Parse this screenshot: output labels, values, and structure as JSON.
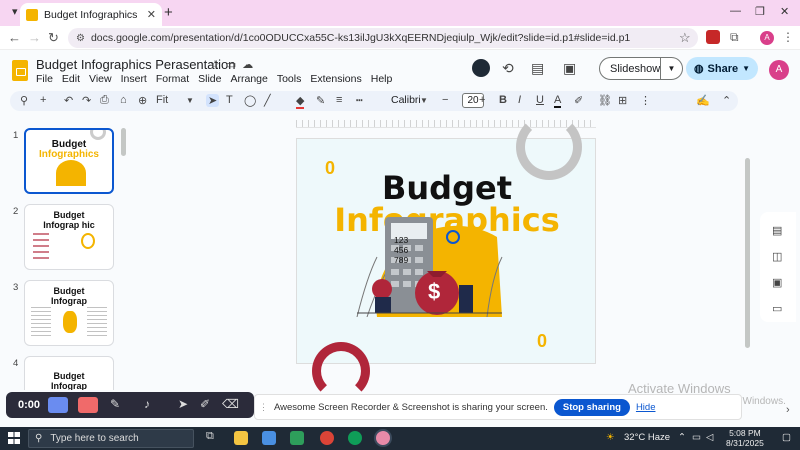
{
  "browser": {
    "tab_title": "Budget Infographics Perasentation",
    "url": "docs.google.com/presentation/d/1co0ODUCCxa55C-ks13ilJgU3kXqEERNDjeqiulp_Wjk/edit?slide=id.p1#slide=id.p1"
  },
  "doc": {
    "title": "Budget Infographics Perasentation",
    "menu": [
      "File",
      "Edit",
      "View",
      "Insert",
      "Format",
      "Slide",
      "Arrange",
      "Tools",
      "Extensions",
      "Help"
    ],
    "slideshow_label": "Slideshow",
    "share_label": "Share",
    "avatar_letter": "A"
  },
  "toolbar": {
    "zoom": "Fit",
    "font": "Calibri",
    "font_size": "20"
  },
  "filmstrip": {
    "slides": [
      {
        "num": "1",
        "title": "Budget",
        "subtitle": "Infographics"
      },
      {
        "num": "2",
        "title": "Budget",
        "subtitle": "Infograp hic"
      },
      {
        "num": "3",
        "title": "Budget",
        "subtitle": "Infograp"
      },
      {
        "num": "4",
        "title": "Budget",
        "subtitle": "Infograp"
      }
    ]
  },
  "slide": {
    "title_line1": "Budget",
    "title_line2": "Infographics",
    "calculator_display": [
      "123",
      "456",
      "789"
    ],
    "dollar_sign": "$",
    "zero_symbol": "0"
  },
  "watermark": {
    "line1": "Activate Windows",
    "line2": "Go to Settings to activate Windows."
  },
  "recorder": {
    "time": "0:00"
  },
  "share_notice": {
    "message": "Awesome Screen Recorder & Screenshot is sharing your screen.",
    "stop_label": "Stop sharing",
    "hide_label": "Hide"
  },
  "taskbar": {
    "search_placeholder": "Type here to search",
    "weather": "32°C  Haze",
    "time": "5:08 PM",
    "date": "8/31/2025"
  },
  "colors": {
    "accent_yellow": "#f4b400",
    "accent_red": "#b0263a",
    "google_blue": "#0b57d0"
  }
}
